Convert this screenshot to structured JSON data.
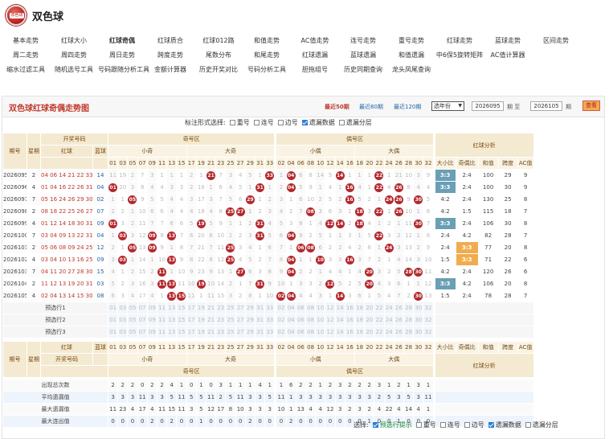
{
  "site": {
    "title": "双色球",
    "logo_text": "双色球"
  },
  "nav": [
    [
      "基本走势",
      "红球大小",
      "红球奇偶",
      "红球质合",
      "红球012路",
      "和值走势",
      "AC值走势",
      "连号走势",
      "重号走势",
      "红球走势",
      "蓝球走势",
      "区间走势"
    ],
    [
      "周二走势",
      "周四走势",
      "周日走势",
      "跨度走势",
      "尾数分布",
      "和尾走势",
      "红球遗漏",
      "蓝球遗漏",
      "和值遗漏",
      "中6保5旋转矩阵",
      "AC值计算器"
    ],
    [
      "缩水过滤工具",
      "随机选号工具",
      "号码跟随分析工具",
      "金额计算器",
      "历史开奖对比",
      "号码分析工具",
      "胆拖组号",
      "历史同期查询",
      "龙头凤尾查询"
    ]
  ],
  "nav_active": "红球奇偶",
  "toolbar": {
    "title": "双色球红球奇偶走势图",
    "quick": [
      "最近50期",
      "最近80期",
      "最近120期"
    ],
    "select_label": "选年份",
    "from": "2026095",
    "mid": "期  至",
    "to": "2026105",
    "tail": "期",
    "query": "查看"
  },
  "options": {
    "label": "标注形式选择:",
    "items": [
      {
        "label": "重号",
        "checked": false
      },
      {
        "label": "连号",
        "checked": false
      },
      {
        "label": "边号",
        "checked": false
      },
      {
        "label": "遗漏数据",
        "checked": true
      },
      {
        "label": "遗漏分层",
        "checked": false
      }
    ]
  },
  "headers": {
    "qihao": "期号",
    "weekday": "星期",
    "open_no": "开奖号码",
    "red": "红球",
    "blue": "蓝球",
    "odd_zone": "奇号区",
    "even_zone": "偶号区",
    "small_odd": "小奇",
    "big_odd": "大奇",
    "small_even": "小偶",
    "big_even": "大偶",
    "analysis": "红球分析",
    "analysis_cols": [
      "大小比",
      "奇偶比",
      "和值",
      "跨度",
      "AC值"
    ]
  },
  "odd_numbers": [
    "01",
    "03",
    "05",
    "07",
    "09",
    "11",
    "13",
    "15",
    "17",
    "19",
    "21",
    "23",
    "25",
    "27",
    "29",
    "31",
    "33"
  ],
  "even_numbers": [
    "02",
    "04",
    "06",
    "08",
    "10",
    "12",
    "14",
    "16",
    "18",
    "20",
    "22",
    "24",
    "26",
    "28",
    "30",
    "32"
  ],
  "draws": [
    {
      "no": "2026095",
      "wd": "2",
      "red": "04 06 14 21 22 33",
      "blue": "14",
      "odd": [
        "11",
        "19",
        "2",
        "7",
        "3",
        "1",
        "1",
        "1",
        "2",
        "1",
        "21",
        "7",
        "3",
        "4",
        "5",
        "1",
        "33"
      ],
      "even": [
        "1",
        "04",
        "6",
        "8",
        "14",
        "5",
        "14",
        "1",
        "1",
        "1",
        "22",
        "1",
        "21",
        "10",
        "3",
        "9"
      ],
      "ratio": [
        "3:3",
        "2:4",
        "100",
        "29",
        "9"
      ]
    },
    {
      "no": "2026096",
      "wd": "4",
      "red": "01 04 16 22 26 31",
      "blue": "04",
      "odd": [
        "01",
        "20",
        "3",
        "8",
        "4",
        "4",
        "3",
        "3",
        "2",
        "16",
        "1",
        "6",
        "4",
        "5",
        "1",
        "31",
        "1"
      ],
      "even": [
        "2",
        "04",
        "5",
        "9",
        "1",
        "4",
        "1",
        "16",
        "4",
        "1",
        "22",
        "4",
        "26",
        "8",
        "4",
        "4"
      ],
      "ratio": [
        "3:3",
        "2:4",
        "100",
        "30",
        "9"
      ]
    },
    {
      "no": "2026097",
      "wd": "7",
      "red": "05 16 24 26 29 30",
      "blue": "02",
      "odd": [
        "1",
        "1",
        "05",
        "9",
        "5",
        "5",
        "4",
        "4",
        "3",
        "17",
        "3",
        "7",
        "5",
        "6",
        "29",
        "1",
        "2"
      ],
      "even": [
        "3",
        "1",
        "6",
        "10",
        "2",
        "5",
        "2",
        "16",
        "5",
        "2",
        "1",
        "24",
        "26",
        "9",
        "30",
        "5"
      ],
      "ratio": [
        "4:2",
        "2:4",
        "130",
        "25",
        "8"
      ]
    },
    {
      "no": "2026098",
      "wd": "2",
      "red": "08 18 22 25 26 27",
      "blue": "07",
      "odd": [
        "2",
        "2",
        "1",
        "10",
        "6",
        "6",
        "4",
        "4",
        "4",
        "18",
        "4",
        "8",
        "25",
        "27",
        "1",
        "2",
        "3"
      ],
      "even": [
        "4",
        "2",
        "7",
        "08",
        "3",
        "6",
        "3",
        "1",
        "18",
        "3",
        "22",
        "1",
        "26",
        "10",
        "1",
        "6"
      ],
      "ratio": [
        "4:2",
        "1:5",
        "115",
        "18",
        "7"
      ]
    },
    {
      "no": "2026099",
      "wd": "4",
      "red": "01 12 14 18 30 31",
      "blue": "09",
      "odd": [
        "01",
        "3",
        "2",
        "11",
        "7",
        "7",
        "6",
        "6",
        "5",
        "19",
        "5",
        "9",
        "1",
        "1",
        "2",
        "31",
        "4"
      ],
      "even": [
        "5",
        "3",
        "8",
        "1",
        "4",
        "12",
        "14",
        "2",
        "18",
        "4",
        "1",
        "2",
        "1",
        "11",
        "30",
        "7"
      ],
      "ratio": [
        "3:3",
        "2:4",
        "106",
        "30",
        "8"
      ]
    },
    {
      "no": "2026100",
      "wd": "7",
      "red": "03 04 09 13 22 31",
      "blue": "04",
      "odd": [
        "1",
        "03",
        "3",
        "12",
        "09",
        "8",
        "13",
        "7",
        "6",
        "20",
        "6",
        "10",
        "2",
        "2",
        "3",
        "31",
        "5"
      ],
      "even": [
        "6",
        "04",
        "9",
        "2",
        "5",
        "1",
        "1",
        "3",
        "1",
        "5",
        "22",
        "3",
        "2",
        "12",
        "1",
        "8"
      ],
      "ratio": [
        "2:4",
        "4:2",
        "82",
        "28",
        "7"
      ]
    },
    {
      "no": "2026101",
      "wd": "2",
      "red": "05 06 08 09 24 25",
      "blue": "12",
      "odd": [
        "2",
        "1",
        "05",
        "13",
        "09",
        "9",
        "1",
        "8",
        "7",
        "21",
        "7",
        "11",
        "25",
        "3",
        "4",
        "1",
        "6"
      ],
      "even": [
        "7",
        "1",
        "06",
        "08",
        "6",
        "2",
        "2",
        "4",
        "2",
        "6",
        "1",
        "24",
        "3",
        "13",
        "2",
        "9"
      ],
      "ratio": [
        "2:4",
        "3:3",
        "77",
        "20",
        "8"
      ]
    },
    {
      "no": "2026102",
      "wd": "4",
      "red": "03 04 10 13 16 25",
      "blue": "09",
      "odd": [
        "3",
        "03",
        "1",
        "14",
        "1",
        "10",
        "13",
        "9",
        "8",
        "22",
        "8",
        "12",
        "25",
        "4",
        "5",
        "2",
        "7"
      ],
      "even": [
        "8",
        "04",
        "1",
        "1",
        "10",
        "3",
        "3",
        "16",
        "3",
        "7",
        "2",
        "1",
        "4",
        "14",
        "3",
        "10"
      ],
      "ratio": [
        "1:5",
        "3:3",
        "71",
        "22",
        "6"
      ]
    },
    {
      "no": "2026103",
      "wd": "7",
      "red": "04 11 20 27 28 30",
      "blue": "15",
      "odd": [
        "4",
        "1",
        "2",
        "15",
        "2",
        "11",
        "1",
        "10",
        "9",
        "23",
        "9",
        "13",
        "1",
        "27",
        "6",
        "3",
        "8"
      ],
      "even": [
        "9",
        "04",
        "2",
        "2",
        "1",
        "4",
        "4",
        "1",
        "4",
        "20",
        "3",
        "2",
        "5",
        "28",
        "30",
        "11"
      ],
      "ratio": [
        "4:2",
        "2:4",
        "120",
        "26",
        "6"
      ]
    },
    {
      "no": "2026104",
      "wd": "2",
      "red": "11 12 13 19 20 31",
      "blue": "03",
      "odd": [
        "5",
        "2",
        "3",
        "16",
        "3",
        "11",
        "13",
        "11",
        "10",
        "19",
        "10",
        "14",
        "2",
        "1",
        "7",
        "31",
        "9"
      ],
      "even": [
        "10",
        "1",
        "3",
        "3",
        "2",
        "12",
        "5",
        "2",
        "5",
        "20",
        "4",
        "3",
        "6",
        "1",
        "1",
        "12"
      ],
      "ratio": [
        "3:3",
        "4:2",
        "106",
        "20",
        "8"
      ]
    },
    {
      "no": "2026105",
      "wd": "4",
      "red": "02 04 13 14 15 30",
      "blue": "08",
      "odd": [
        "6",
        "3",
        "4",
        "17",
        "4",
        "1",
        "13",
        "15",
        "11",
        "1",
        "11",
        "15",
        "3",
        "2",
        "8",
        "1",
        "10"
      ],
      "even": [
        "02",
        "04",
        "4",
        "4",
        "3",
        "1",
        "14",
        "3",
        "6",
        "1",
        "5",
        "4",
        "7",
        "2",
        "30",
        "13"
      ],
      "ratio": [
        "1:5",
        "2:4",
        "78",
        "28",
        "7"
      ]
    }
  ],
  "prediction_rows": [
    "预选行1",
    "预选行2",
    "预选行3"
  ],
  "stats": [
    {
      "label": "出现总次数",
      "odd": [
        "2",
        "2",
        "2",
        "0",
        "2",
        "2",
        "4",
        "1",
        "0",
        "1",
        "0",
        "3",
        "1",
        "1",
        "1",
        "4",
        "1"
      ],
      "even": [
        "1",
        "6",
        "2",
        "2",
        "1",
        "2",
        "3",
        "2",
        "2",
        "2",
        "3",
        "1",
        "2",
        "1",
        "3",
        "1",
        "4",
        "0"
      ]
    },
    {
      "label": "平均遗漏值",
      "odd": [
        "3",
        "3",
        "3",
        "11",
        "3",
        "3",
        "5",
        "11",
        "5",
        "5",
        "11",
        "2",
        "5",
        "11",
        "3",
        "3",
        "5"
      ],
      "even": [
        "11",
        "1",
        "3",
        "3",
        "3",
        "3",
        "3",
        "3",
        "3",
        "3",
        "2",
        "5",
        "3",
        "5",
        "3",
        "11"
      ]
    },
    {
      "label": "最大遗漏值",
      "odd": [
        "11",
        "23",
        "4",
        "17",
        "4",
        "11",
        "15",
        "11",
        "3",
        "5",
        "12",
        "17",
        "8",
        "10",
        "3",
        "3",
        "3"
      ],
      "even": [
        "10",
        "1",
        "13",
        "4",
        "4",
        "12",
        "3",
        "2",
        "3",
        "2",
        "4",
        "22",
        "4",
        "14",
        "4",
        "1"
      ]
    },
    {
      "label": "最大连出值",
      "odd": [
        "0",
        "0",
        "0",
        "0",
        "2",
        "0",
        "2",
        "0",
        "0",
        "1",
        "0",
        "0",
        "0",
        "0",
        "2",
        "0",
        "0"
      ],
      "even": [
        "0",
        "2",
        "0",
        "0",
        "0",
        "0",
        "0",
        "0",
        "0",
        "1",
        "0",
        "0",
        "1",
        "0",
        "0",
        "0"
      ]
    }
  ],
  "footer": {
    "label": "选择:",
    "items": [
      {
        "label": "预选行提示",
        "checked": true,
        "hl": true
      },
      {
        "label": "重号",
        "checked": false
      },
      {
        "label": "连号",
        "checked": false
      },
      {
        "label": "边号",
        "checked": false
      },
      {
        "label": "遗漏数据",
        "checked": true
      },
      {
        "label": "遗漏分层",
        "checked": false
      }
    ]
  }
}
